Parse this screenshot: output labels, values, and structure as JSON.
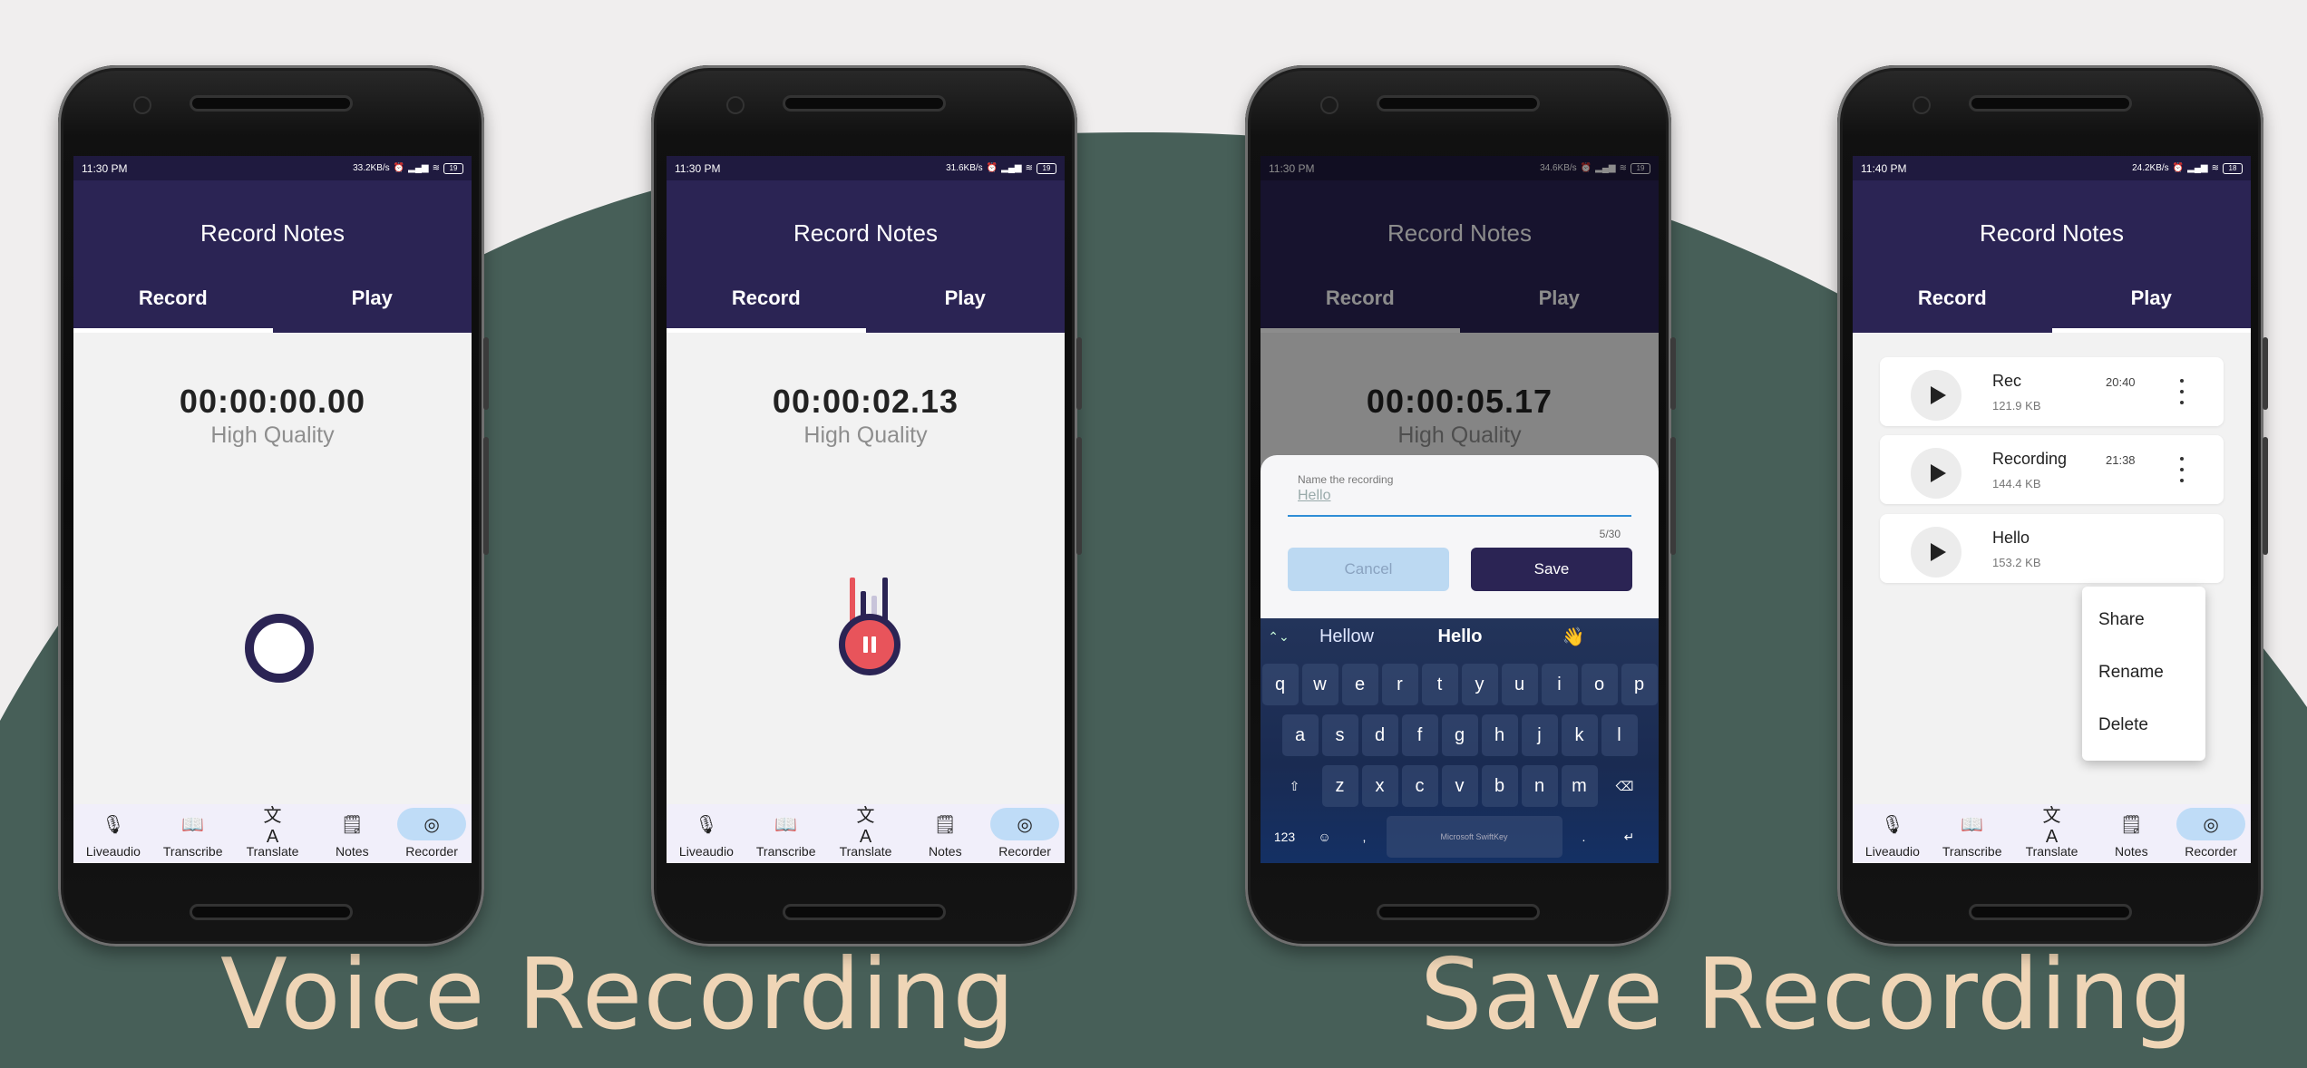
{
  "captions": {
    "left": "Voice Recording",
    "right": "Save Recording"
  },
  "colors": {
    "background": "#f0eeee",
    "green_arc": "#475f58",
    "caption": "#efd5b6",
    "appbar": "#2b2454",
    "accent_red": "#e8545b",
    "nav_pill": "#bfdcf7"
  },
  "app": {
    "title": "Record Notes",
    "tab_record": "Record",
    "tab_play": "Play",
    "quality": "High Quality"
  },
  "nav": {
    "items": [
      {
        "label": "Liveaudio",
        "icon": "liveaudio-icon"
      },
      {
        "label": "Transcribe",
        "icon": "transcribe-icon"
      },
      {
        "label": "Translate",
        "icon": "translate-icon"
      },
      {
        "label": "Notes",
        "icon": "notes-icon"
      },
      {
        "label": "Recorder",
        "icon": "recorder-icon"
      }
    ]
  },
  "phones": [
    {
      "time": "11:30 PM",
      "speed": "33.2KB/s",
      "battery": "19",
      "timer": "00:00:00.00"
    },
    {
      "time": "11:30 PM",
      "speed": "31.6KB/s",
      "battery": "19",
      "timer": "00:00:02.13"
    },
    {
      "time": "11:30 PM",
      "speed": "34.6KB/s",
      "battery": "19",
      "timer": "00:00:05.17"
    },
    {
      "time": "11:40 PM",
      "speed": "24.2KB/s",
      "battery": "18"
    }
  ],
  "dialog": {
    "label": "Name the recording",
    "value": "Hello",
    "counter": "5/30",
    "cancel": "Cancel",
    "save": "Save"
  },
  "keyboard": {
    "suggestions": [
      "Hellow",
      "Hello",
      "👋"
    ],
    "row1": [
      "q",
      "w",
      "e",
      "r",
      "t",
      "y",
      "u",
      "i",
      "o",
      "p"
    ],
    "row2": [
      "a",
      "s",
      "d",
      "f",
      "g",
      "h",
      "j",
      "k",
      "l"
    ],
    "row3": [
      "z",
      "x",
      "c",
      "v",
      "b",
      "n",
      "m"
    ],
    "num_key": "123",
    "space_label": "Microsoft SwiftKey"
  },
  "recordings": [
    {
      "name": "Rec",
      "size": "121.9 KB",
      "time": "20:40"
    },
    {
      "name": "Recording",
      "size": "144.4 KB",
      "time": "21:38"
    },
    {
      "name": "Hello",
      "size": "153.2 KB",
      "time": ""
    }
  ],
  "context_menu": {
    "share": "Share",
    "rename": "Rename",
    "delete": "Delete"
  }
}
